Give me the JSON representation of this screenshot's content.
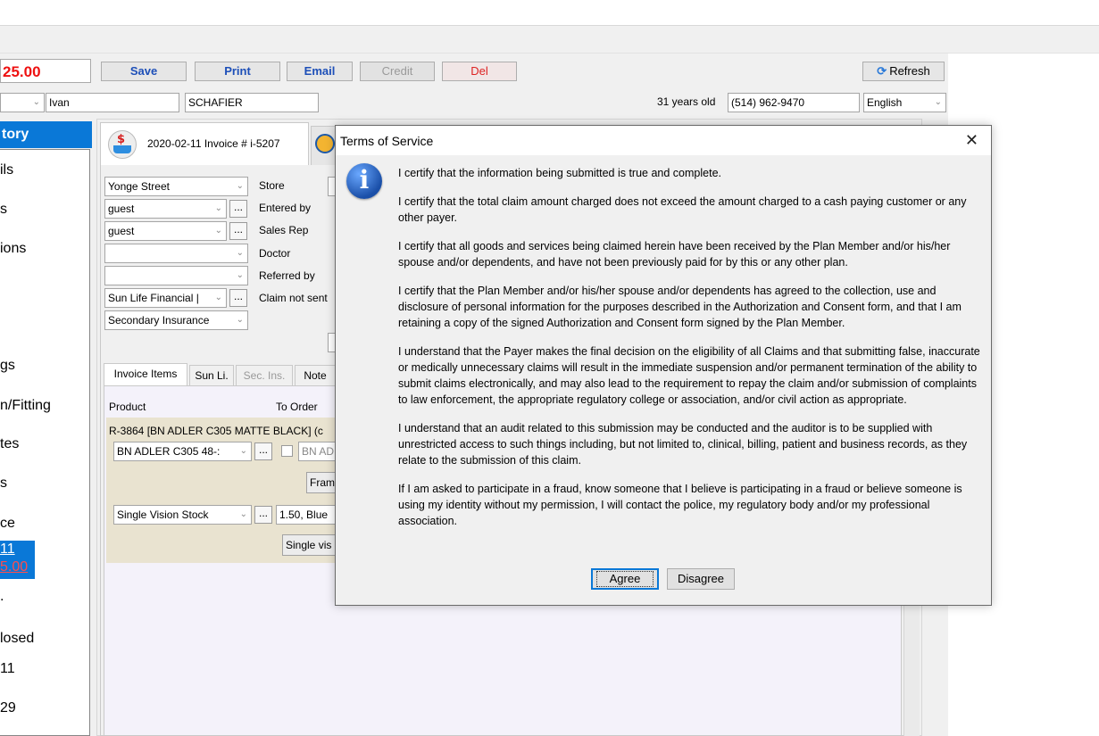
{
  "header": {
    "total": "25.00",
    "buttons": {
      "save": "Save",
      "print": "Print",
      "email": "Email",
      "credit": "Credit",
      "del": "Del"
    },
    "refresh": "Refresh",
    "first_name": "Ivan",
    "last_name": "SCHAFIER",
    "age": "31 years old",
    "phone": "(514) 962-9470",
    "language": "English"
  },
  "sidebar": {
    "selected": "tory",
    "items": [
      "ils",
      "s",
      "ions",
      "gs",
      "n/Fitting",
      "tes",
      "s",
      "ce"
    ],
    "highlight": {
      "date": "11",
      "amount": "5.00"
    },
    "after": [
      ".",
      "losed",
      "11",
      "29"
    ]
  },
  "invoice": {
    "tab_label": "2020-02-11 Invoice # i-5207",
    "fields": {
      "store_value": "Yonge Street",
      "store_label": "Store",
      "entered_by_value": "guest",
      "entered_by_label": "Entered by",
      "sales_rep_value": "guest",
      "sales_rep_label": "Sales Rep",
      "doctor_value": "",
      "doctor_label": "Doctor",
      "referred_value": "",
      "referred_label": "Referred by",
      "insurance_value": "Sun Life Financial |",
      "claim_label": "Claim not sent",
      "secondary_value": "Secondary Insurance"
    },
    "subtabs": [
      "Invoice Items",
      "Sun Li.",
      "Sec. Ins.",
      "Note"
    ],
    "columns": {
      "product": "Product",
      "to_order": "To Order"
    },
    "item1": {
      "title": "R-3864 [BN ADLER C305 MATTE BLACK] (c",
      "combo": "BN ADLER C305  48-:",
      "field": "BN AD",
      "button": "Fram"
    },
    "item2": {
      "combo": "Single Vision Stock",
      "field": "1.50, Blue",
      "button": "Single vis"
    }
  },
  "dialog": {
    "title": "Terms of Service",
    "paragraphs": [
      "I certify that the information being submitted is true and complete.",
      "I certify that the total claim amount charged does not exceed the amount charged to a cash paying customer or any other payer.",
      "I certify that all goods and services being claimed herein have been received by the Plan Member and/or his/her spouse and/or dependents, and have not been previously paid for by this or any other plan.",
      "I certify that the Plan Member and/or his/her spouse and/or dependents has agreed to the collection, use and disclosure of personal information for the purposes described in the Authorization and Consent form, and that I am retaining a copy of the signed Authorization and Consent form signed by the Plan Member.",
      "I understand that the Payer makes the final decision on the eligibility of all Claims and that submitting false, inaccurate or medically unnecessary claims will result in the immediate suspension and/or permanent termination of the ability to submit claims electronically, and may also lead to the requirement to repay the claim and/or submission of complaints to law enforcement, the appropriate regulatory college or association, and/or civil action as appropriate.",
      "I understand that an audit related to this submission may be conducted and the auditor is to be supplied with unrestricted access to such things including, but not limited to, clinical, billing, patient and business records, as they relate to the submission of this claim.",
      "If I am asked to participate in a fraud, know someone that I believe is participating in a fraud or believe someone is using my identity without my permission, I will contact the police, my regulatory body and/or my professional association."
    ],
    "agree": "Agree",
    "disagree": "Disagree",
    "icon": "info-icon"
  }
}
